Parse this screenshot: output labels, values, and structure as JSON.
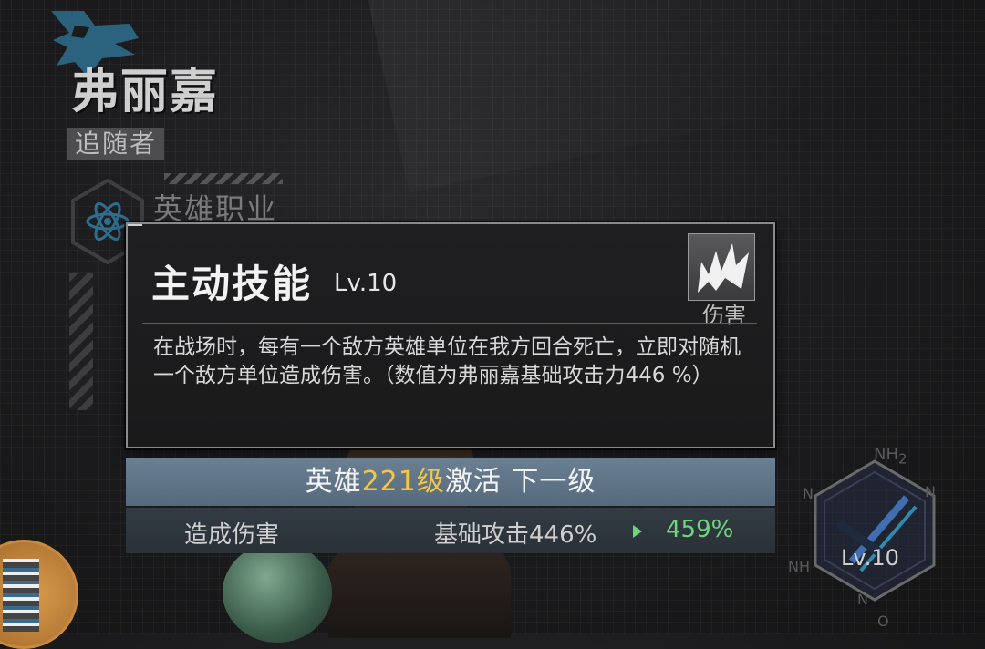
{
  "hero": {
    "name": "弗丽嘉",
    "title": "追随者",
    "class_label": "英雄职业",
    "logo_icon": "dragon-emblem-icon",
    "class_icon": "atom-icon"
  },
  "skill": {
    "title": "主动技能",
    "level": "Lv.10",
    "tag": "伤害",
    "icon": "slash-damage-icon",
    "description": "在战场时，每有一个敌方英雄单位在我方回合死亡，立即对随机一个敌方单位造成伤害。（数值为弗丽嘉基础攻击力446 %）"
  },
  "unlock": {
    "prefix": "英雄",
    "level": "221级",
    "suffix": "激活 下一级",
    "highlight_color": "#f3c542"
  },
  "stat": {
    "label": "造成伤害",
    "base": "基础攻击446%",
    "next": "459%",
    "next_color": "#6fd47c"
  },
  "badge": {
    "level": "Lv.10",
    "nh2": "NH",
    "nh2_sub": "2",
    "n_left": "N",
    "n_right": "N",
    "nh": "NH",
    "n_bottom": "N",
    "o": "O"
  }
}
